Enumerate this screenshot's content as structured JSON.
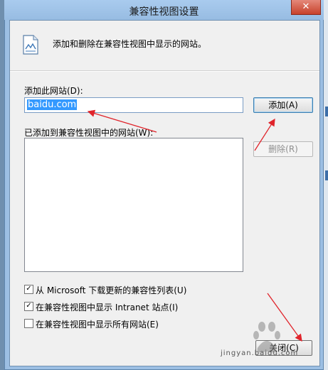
{
  "window": {
    "title": "兼容性视图设置",
    "close_glyph": "✕"
  },
  "header": {
    "description": "添加和删除在兼容性视图中显示的网站。"
  },
  "add_site": {
    "label": "添加此网站(D):",
    "value": "baidu.com",
    "add_button": "添加(A)"
  },
  "site_list": {
    "label": "已添加到兼容性视图中的网站(W):",
    "items": [],
    "remove_button": "删除(R)"
  },
  "options": [
    {
      "label": "从 Microsoft 下载更新的兼容性列表(U)",
      "checked": true
    },
    {
      "label": "在兼容性视图中显示 Intranet 站点(I)",
      "checked": true
    },
    {
      "label": "在兼容性视图中显示所有网站(E)",
      "checked": false
    }
  ],
  "footer": {
    "close_button": "关闭(C)"
  },
  "watermark": {
    "text": "jingyan.baidu.com"
  },
  "colors": {
    "annotation_arrow": "#e0242b",
    "selection": "#3399ff"
  }
}
